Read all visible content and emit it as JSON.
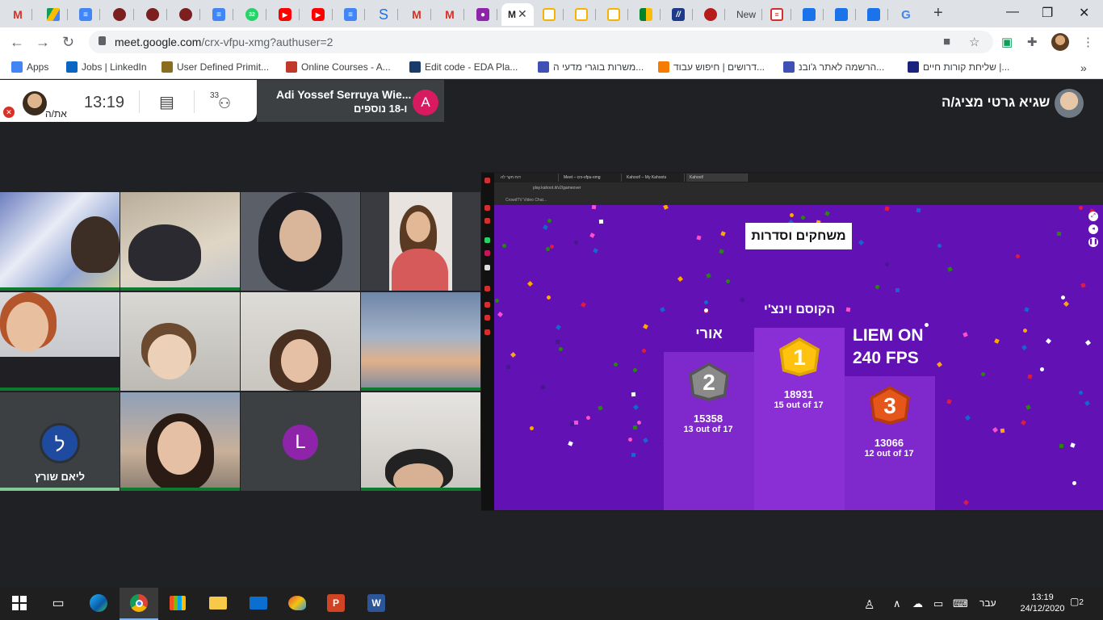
{
  "browser": {
    "url_host": "meet.google.com",
    "url_path": "/crx-vfpu-xmg?authuser=2",
    "tab_new_label": "New",
    "tab_badge": "32"
  },
  "bookmarks": [
    {
      "label": "Apps",
      "color": "#4285f4"
    },
    {
      "label": "Jobs | LinkedIn",
      "color": "#0a66c2"
    },
    {
      "label": "User Defined Primit...",
      "color": "#8a6d1f"
    },
    {
      "label": "Online Courses - A...",
      "color": "#c0392b"
    },
    {
      "label": "Edit code - EDA Pla...",
      "color": "#1a3a6b"
    },
    {
      "label": "משרות בוגרי מדעי ה...",
      "color": "#3f51b5"
    },
    {
      "label": "דרושים | חיפוש עבוד...",
      "color": "#f57c00"
    },
    {
      "label": "הרשמה לאתר ג'ובנ...",
      "color": "#3f51b5"
    },
    {
      "label": "שליחת קורות חיים |...",
      "color": "#1a237e"
    }
  ],
  "meet": {
    "self_label": "את/ה",
    "clock": "13:19",
    "participants_count": "33",
    "presenting_user": "Adi Yossef Serruya Wie...",
    "presenting_more": "ו-18 נוספים",
    "presenting_initial": "A",
    "presenter_name": "שגיא גרטי מציג/ה",
    "tiles": [
      {
        "kind": "video"
      },
      {
        "kind": "video"
      },
      {
        "kind": "video"
      },
      {
        "kind": "video"
      },
      {
        "kind": "video"
      },
      {
        "kind": "video"
      },
      {
        "kind": "video"
      },
      {
        "kind": "video"
      },
      {
        "kind": "avatar",
        "initial": "ל",
        "name": "ליאם שורץ",
        "color": "#1e4ba0"
      },
      {
        "kind": "video"
      },
      {
        "kind": "avatar",
        "initial": "L",
        "name": "",
        "color": "#8e24aa"
      },
      {
        "kind": "video"
      }
    ]
  },
  "shared_screen": {
    "tabs": [
      "דוח חקר לה",
      "Meet – crx-vfpu-xmg",
      "Kahoot! – My Kahoots",
      "Kahoot!"
    ],
    "address": "play.kahoot.it/v2/gameover",
    "bookmark": "CrowdTV Video Chat...",
    "title": "משחקים וסדרות",
    "podium": [
      {
        "place": "1",
        "name": "הקוסם וינצ'י",
        "score": "18931",
        "correct": "15 out of 17"
      },
      {
        "place": "2",
        "name": "אורי",
        "score": "15358",
        "correct": "13 out of 17"
      },
      {
        "place": "3",
        "name": "LIEM ON 240 FPS",
        "score": "13066",
        "correct": "12 out of 17"
      }
    ]
  },
  "taskbar": {
    "lang": "עבר",
    "time": "13:19",
    "date": "24/12/2020",
    "notifications": "2"
  }
}
